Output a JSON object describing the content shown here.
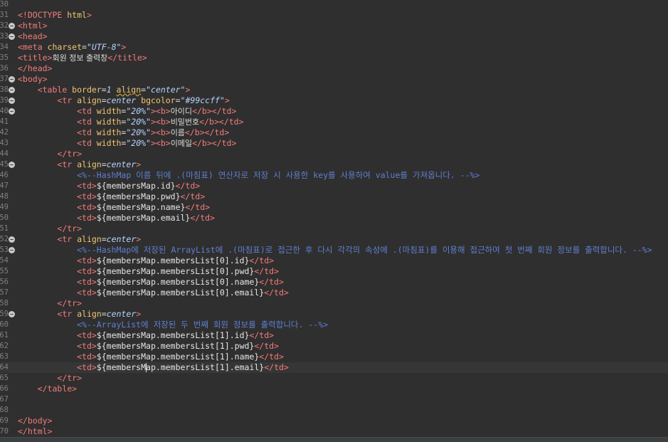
{
  "editor": {
    "lines": [
      {
        "n": "30",
        "fold": false,
        "tokens": []
      },
      {
        "n": "31",
        "fold": false,
        "tokens": [
          {
            "c": "tag",
            "t": "<!DOCTYPE "
          },
          {
            "c": "attr",
            "t": "html"
          },
          {
            "c": "tag",
            "t": ">"
          }
        ]
      },
      {
        "n": "32",
        "fold": true,
        "tokens": [
          {
            "c": "tag",
            "t": "<html>"
          }
        ]
      },
      {
        "n": "33",
        "fold": true,
        "tokens": [
          {
            "c": "tag",
            "t": "<head>"
          }
        ]
      },
      {
        "n": "34",
        "fold": false,
        "tokens": [
          {
            "c": "tag",
            "t": "<meta "
          },
          {
            "c": "attr",
            "t": "charset"
          },
          {
            "c": "txt",
            "t": "="
          },
          {
            "c": "val",
            "t": "\"UTF-8\""
          },
          {
            "c": "tag",
            "t": ">"
          }
        ]
      },
      {
        "n": "35",
        "fold": false,
        "tokens": [
          {
            "c": "tag",
            "t": "<title>"
          },
          {
            "c": "ko",
            "t": "회원 정보 출력창"
          },
          {
            "c": "tag",
            "t": "</title>"
          }
        ]
      },
      {
        "n": "36",
        "fold": false,
        "tokens": [
          {
            "c": "tag",
            "t": "</head>"
          }
        ]
      },
      {
        "n": "37",
        "fold": true,
        "tokens": [
          {
            "c": "tag",
            "t": "<body>"
          }
        ]
      },
      {
        "n": "38",
        "fold": true,
        "tokens": [
          {
            "c": "txt",
            "t": "    "
          },
          {
            "c": "tag",
            "t": "<table "
          },
          {
            "c": "attr",
            "t": "border"
          },
          {
            "c": "txt",
            "t": "="
          },
          {
            "c": "val",
            "t": "1"
          },
          {
            "c": "txt",
            "t": " "
          },
          {
            "c": "attr squig",
            "t": "align"
          },
          {
            "c": "txt",
            "t": "="
          },
          {
            "c": "val",
            "t": "\"center\""
          },
          {
            "c": "tag",
            "t": ">"
          }
        ]
      },
      {
        "n": "39",
        "fold": true,
        "tokens": [
          {
            "c": "txt",
            "t": "        "
          },
          {
            "c": "tag",
            "t": "<tr "
          },
          {
            "c": "attr",
            "t": "align"
          },
          {
            "c": "txt",
            "t": "="
          },
          {
            "c": "val",
            "t": "center"
          },
          {
            "c": "txt",
            "t": " "
          },
          {
            "c": "attr",
            "t": "bgcolor"
          },
          {
            "c": "txt",
            "t": "="
          },
          {
            "c": "val",
            "t": "\"#99ccff\""
          },
          {
            "c": "tag",
            "t": ">"
          }
        ]
      },
      {
        "n": "40",
        "fold": true,
        "tokens": [
          {
            "c": "txt",
            "t": "            "
          },
          {
            "c": "tag",
            "t": "<td "
          },
          {
            "c": "attr",
            "t": "width"
          },
          {
            "c": "txt",
            "t": "="
          },
          {
            "c": "val",
            "t": "\"20%\""
          },
          {
            "c": "tag",
            "t": "><b>"
          },
          {
            "c": "ko",
            "t": "아이디"
          },
          {
            "c": "tag",
            "t": "</b></td>"
          }
        ]
      },
      {
        "n": "41",
        "fold": false,
        "tokens": [
          {
            "c": "txt",
            "t": "            "
          },
          {
            "c": "tag",
            "t": "<td "
          },
          {
            "c": "attr",
            "t": "width"
          },
          {
            "c": "txt",
            "t": "="
          },
          {
            "c": "val",
            "t": "\"20%\""
          },
          {
            "c": "tag",
            "t": "><b>"
          },
          {
            "c": "ko",
            "t": "비밀번호"
          },
          {
            "c": "tag",
            "t": "</b></td>"
          }
        ]
      },
      {
        "n": "42",
        "fold": false,
        "tokens": [
          {
            "c": "txt",
            "t": "            "
          },
          {
            "c": "tag",
            "t": "<td "
          },
          {
            "c": "attr",
            "t": "width"
          },
          {
            "c": "txt",
            "t": "="
          },
          {
            "c": "val",
            "t": "\"20%\""
          },
          {
            "c": "tag",
            "t": "><b>"
          },
          {
            "c": "ko",
            "t": "이름"
          },
          {
            "c": "tag",
            "t": "</b></td>"
          }
        ]
      },
      {
        "n": "43",
        "fold": false,
        "tokens": [
          {
            "c": "txt",
            "t": "            "
          },
          {
            "c": "tag",
            "t": "<td "
          },
          {
            "c": "attr",
            "t": "width"
          },
          {
            "c": "txt",
            "t": "="
          },
          {
            "c": "val",
            "t": "\"20%\""
          },
          {
            "c": "tag",
            "t": "><b>"
          },
          {
            "c": "ko",
            "t": "이메일"
          },
          {
            "c": "tag",
            "t": "</b></td>"
          }
        ]
      },
      {
        "n": "44",
        "fold": false,
        "tokens": [
          {
            "c": "txt",
            "t": "        "
          },
          {
            "c": "tag",
            "t": "</tr>"
          }
        ]
      },
      {
        "n": "45",
        "fold": true,
        "tokens": [
          {
            "c": "txt",
            "t": "        "
          },
          {
            "c": "tag",
            "t": "<tr "
          },
          {
            "c": "attr",
            "t": "align"
          },
          {
            "c": "txt",
            "t": "="
          },
          {
            "c": "val",
            "t": "center"
          },
          {
            "c": "tag",
            "t": ">"
          }
        ]
      },
      {
        "n": "46",
        "fold": false,
        "tokens": [
          {
            "c": "txt",
            "t": "            "
          },
          {
            "c": "cm",
            "t": "<%--HashMap 이름 뒤에 .(마침표) 연산자로 저장 시 사용한 key를 사용하여 value를 가져옵니다. --%>"
          }
        ]
      },
      {
        "n": "47",
        "fold": false,
        "tokens": [
          {
            "c": "txt",
            "t": "            "
          },
          {
            "c": "tag",
            "t": "<td>"
          },
          {
            "c": "el",
            "t": "${membersMap.id}"
          },
          {
            "c": "tag",
            "t": "</td>"
          }
        ]
      },
      {
        "n": "48",
        "fold": false,
        "tokens": [
          {
            "c": "txt",
            "t": "            "
          },
          {
            "c": "tag",
            "t": "<td>"
          },
          {
            "c": "el",
            "t": "${membersMap.pwd}"
          },
          {
            "c": "tag",
            "t": "</td>"
          }
        ]
      },
      {
        "n": "49",
        "fold": false,
        "tokens": [
          {
            "c": "txt",
            "t": "            "
          },
          {
            "c": "tag",
            "t": "<td>"
          },
          {
            "c": "el",
            "t": "${membersMap.name}"
          },
          {
            "c": "tag",
            "t": "</td>"
          }
        ]
      },
      {
        "n": "50",
        "fold": false,
        "tokens": [
          {
            "c": "txt",
            "t": "            "
          },
          {
            "c": "tag",
            "t": "<td>"
          },
          {
            "c": "el",
            "t": "${membersMap.email}"
          },
          {
            "c": "tag",
            "t": "</td>"
          }
        ]
      },
      {
        "n": "51",
        "fold": false,
        "tokens": [
          {
            "c": "txt",
            "t": "        "
          },
          {
            "c": "tag",
            "t": "</tr>"
          }
        ]
      },
      {
        "n": "52",
        "fold": true,
        "tokens": [
          {
            "c": "txt",
            "t": "        "
          },
          {
            "c": "tag",
            "t": "<tr "
          },
          {
            "c": "attr",
            "t": "align"
          },
          {
            "c": "txt",
            "t": "="
          },
          {
            "c": "val",
            "t": "center"
          },
          {
            "c": "tag",
            "t": ">"
          }
        ]
      },
      {
        "n": "53",
        "fold": true,
        "tokens": [
          {
            "c": "txt",
            "t": "            "
          },
          {
            "c": "cm",
            "t": "<%--HashMap에 저장된 ArrayList에 .(마침표)로 접근한 후 다시 각각의 속성에 .(마침표)를 이용해 접근하여 첫 번째 회원 정보를 출력합니다. --%>"
          }
        ]
      },
      {
        "n": "54",
        "fold": false,
        "tokens": [
          {
            "c": "txt",
            "t": "            "
          },
          {
            "c": "tag",
            "t": "<td>"
          },
          {
            "c": "el",
            "t": "${membersMap.membersList[0].id}"
          },
          {
            "c": "tag",
            "t": "</td>"
          }
        ]
      },
      {
        "n": "55",
        "fold": false,
        "tokens": [
          {
            "c": "txt",
            "t": "            "
          },
          {
            "c": "tag",
            "t": "<td>"
          },
          {
            "c": "el",
            "t": "${membersMap.membersList[0].pwd}"
          },
          {
            "c": "tag",
            "t": "</td>"
          }
        ]
      },
      {
        "n": "56",
        "fold": false,
        "tokens": [
          {
            "c": "txt",
            "t": "            "
          },
          {
            "c": "tag",
            "t": "<td>"
          },
          {
            "c": "el",
            "t": "${membersMap.membersList[0].name}"
          },
          {
            "c": "tag",
            "t": "</td>"
          }
        ]
      },
      {
        "n": "57",
        "fold": false,
        "tokens": [
          {
            "c": "txt",
            "t": "            "
          },
          {
            "c": "tag",
            "t": "<td>"
          },
          {
            "c": "el",
            "t": "${membersMap.membersList[0].email}"
          },
          {
            "c": "tag",
            "t": "</td>"
          }
        ]
      },
      {
        "n": "58",
        "fold": false,
        "tokens": [
          {
            "c": "txt",
            "t": "        "
          },
          {
            "c": "tag",
            "t": "</tr>"
          }
        ]
      },
      {
        "n": "59",
        "fold": true,
        "tokens": [
          {
            "c": "txt",
            "t": "        "
          },
          {
            "c": "tag",
            "t": "<tr "
          },
          {
            "c": "attr",
            "t": "align"
          },
          {
            "c": "txt",
            "t": "="
          },
          {
            "c": "val",
            "t": "center"
          },
          {
            "c": "tag",
            "t": ">"
          }
        ]
      },
      {
        "n": "60",
        "fold": false,
        "tokens": [
          {
            "c": "txt",
            "t": "            "
          },
          {
            "c": "cm",
            "t": "<%--ArrayList에 저장된 두 번째 회원 정보를 출력합니다. --%>"
          }
        ]
      },
      {
        "n": "61",
        "fold": false,
        "tokens": [
          {
            "c": "txt",
            "t": "            "
          },
          {
            "c": "tag",
            "t": "<td>"
          },
          {
            "c": "el",
            "t": "${membersMap.membersList[1].id}"
          },
          {
            "c": "tag",
            "t": "</td>"
          }
        ]
      },
      {
        "n": "62",
        "fold": false,
        "tokens": [
          {
            "c": "txt",
            "t": "            "
          },
          {
            "c": "tag",
            "t": "<td>"
          },
          {
            "c": "el",
            "t": "${membersMap.membersList[1].pwd}"
          },
          {
            "c": "tag",
            "t": "</td>"
          }
        ]
      },
      {
        "n": "63",
        "fold": false,
        "tokens": [
          {
            "c": "txt",
            "t": "            "
          },
          {
            "c": "tag",
            "t": "<td>"
          },
          {
            "c": "el",
            "t": "${membersMap.membersList[1].name}"
          },
          {
            "c": "tag",
            "t": "</td>"
          }
        ]
      },
      {
        "n": "64",
        "fold": false,
        "current": true,
        "tokens": [
          {
            "c": "txt",
            "t": "            "
          },
          {
            "c": "tag",
            "t": "<td>"
          },
          {
            "c": "el",
            "t": "${membersM"
          },
          {
            "c": "caret",
            "t": ""
          },
          {
            "c": "el",
            "t": "ap.membersList[1].email}"
          },
          {
            "c": "tag",
            "t": "</td>"
          }
        ]
      },
      {
        "n": "65",
        "fold": false,
        "tokens": [
          {
            "c": "txt",
            "t": "        "
          },
          {
            "c": "tag",
            "t": "</tr>"
          }
        ]
      },
      {
        "n": "66",
        "fold": false,
        "tokens": [
          {
            "c": "txt",
            "t": "    "
          },
          {
            "c": "tag",
            "t": "</table>"
          }
        ]
      },
      {
        "n": "67",
        "fold": false,
        "tokens": []
      },
      {
        "n": "68",
        "fold": false,
        "tokens": []
      },
      {
        "n": "69",
        "fold": false,
        "tokens": [
          {
            "c": "tag",
            "t": "</body>"
          }
        ]
      },
      {
        "n": "70",
        "fold": false,
        "tokens": [
          {
            "c": "tag",
            "t": "</html>"
          }
        ]
      }
    ]
  }
}
